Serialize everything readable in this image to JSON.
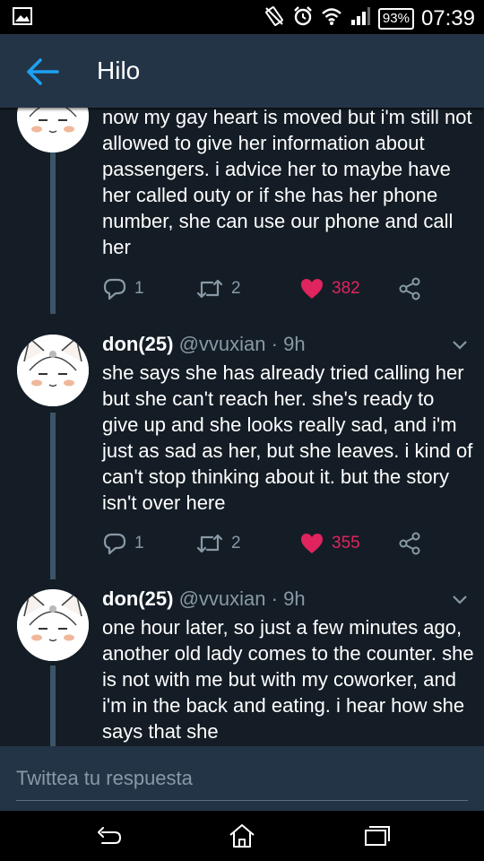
{
  "status_bar": {
    "battery": "93%",
    "time": "07:39",
    "icons": [
      "image-icon",
      "vibrate-icon",
      "alarm-icon",
      "wifi-icon",
      "signal-icon",
      "battery-icon"
    ]
  },
  "header": {
    "title": "Hilo",
    "back_icon": "arrow-left-icon"
  },
  "colors": {
    "background": "#141d26",
    "header": "#243447",
    "accent": "#1da1f2",
    "like": "#e0245e",
    "muted": "#8899a6"
  },
  "tweets": [
    {
      "name": "",
      "handle": "",
      "time": "",
      "text": "now my gay heart is moved but i'm still not allowed to give her information about passengers. i advice her to maybe have her called outy or if she has her phone number, she can use our phone and call her",
      "replies": "1",
      "retweets": "2",
      "likes": "382"
    },
    {
      "name": "don(25)",
      "handle": "@vvuxian",
      "time": "· 9h",
      "text": "she says she has already tried calling her but she can't reach her. she's ready to give up and she looks really sad, and i'm just as sad as her, but she leaves. i kind of can't stop thinking about it. but the story isn't over here",
      "replies": "1",
      "retweets": "2",
      "likes": "355"
    },
    {
      "name": "don(25)",
      "handle": "@vvuxian",
      "time": "· 9h",
      "text": "one hour later, so just a few minutes ago, another old lady comes to the counter. she is not with me but with my coworker, and i'm in the back and eating. i hear how she says that she"
    }
  ],
  "reply_bar": {
    "placeholder": "Twittea tu respuesta"
  },
  "nav_bar": {
    "icons": [
      "back-nav-icon",
      "home-nav-icon",
      "recents-nav-icon"
    ]
  }
}
